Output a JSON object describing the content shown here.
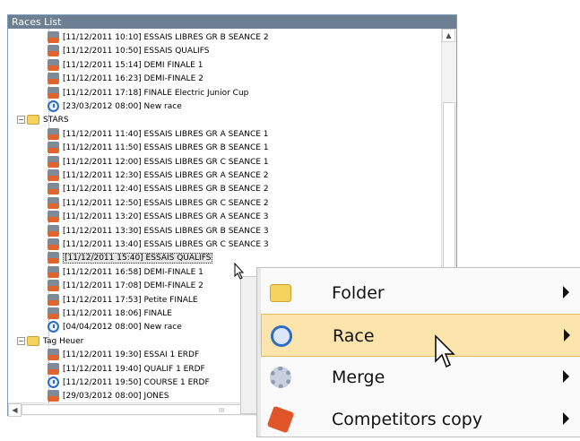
{
  "panel": {
    "title": "Races List"
  },
  "tree": {
    "rows": [
      {
        "text": "[11/12/2011 10:10] ESSAIS LIBRES GR B SEANCE 2",
        "icon": "race-old"
      },
      {
        "text": "[11/12/2011 10:50] ESSAIS QUALIFS",
        "icon": "race-old"
      },
      {
        "text": "[11/12/2011 15:14] DEMI FINALE 1",
        "icon": "race-old"
      },
      {
        "text": "[11/12/2011 16:23] DEMI-FINALE 2",
        "icon": "race-old"
      },
      {
        "text": "[11/12/2011 17:18] FINALE Electric Junior Cup",
        "icon": "race-old"
      },
      {
        "text": "[23/03/2012 08:00] New race",
        "icon": "race-new"
      },
      {
        "text": "STARS",
        "icon": "folder",
        "folder": true
      },
      {
        "text": "[11/12/2011 11:40] ESSAIS LIBRES GR A SEANCE 1",
        "icon": "race-old"
      },
      {
        "text": "[11/12/2011 11:50] ESSAIS LIBRES GR B SEANCE 1",
        "icon": "race-old"
      },
      {
        "text": "[11/12/2011 12:00] ESSAIS LIBRES GR C SEANCE 1",
        "icon": "race-old"
      },
      {
        "text": "[11/12/2011 12:30] ESSAIS LIBRES GR A SEANCE 2",
        "icon": "race-old"
      },
      {
        "text": "[11/12/2011 12:40] ESSAIS LIBRES GR B SEANCE 2",
        "icon": "race-old"
      },
      {
        "text": "[11/12/2011 12:50] ESSAIS LIBRES GR C SEANCE 2",
        "icon": "race-old"
      },
      {
        "text": "[11/12/2011 13:20] ESSAIS LIBRES GR A SEANCE 3",
        "icon": "race-old"
      },
      {
        "text": "[11/12/2011 13:30] ESSAIS LIBRES GR B SEANCE 3",
        "icon": "race-old"
      },
      {
        "text": "[11/12/2011 13:40] ESSAIS LIBRES GR C SEANCE 3",
        "icon": "race-old"
      },
      {
        "text": "[11/12/2011 15:40] ESSAIS QUALIFS",
        "icon": "race-old",
        "selected": true
      },
      {
        "text": "[11/12/2011 16:58] DEMI-FINALE 1",
        "icon": "race-old"
      },
      {
        "text": "[11/12/2011 17:08] DEMI-FINALE 2",
        "icon": "race-old"
      },
      {
        "text": "[11/12/2011 17:53] Petite FINALE",
        "icon": "race-old"
      },
      {
        "text": "[11/12/2011 18:06] FINALE",
        "icon": "race-old"
      },
      {
        "text": "[04/04/2012 08:00] New race",
        "icon": "race-new"
      },
      {
        "text": "Tag Heuer",
        "icon": "folder",
        "folder": true
      },
      {
        "text": "[11/12/2011 19:30] ESSAI 1 ERDF",
        "icon": "race-old"
      },
      {
        "text": "[11/12/2011 19:40] QUALIF 1 ERDF",
        "icon": "race-old"
      },
      {
        "text": "[11/12/2011 19:50] COURSE 1 ERDF",
        "icon": "race-new"
      },
      {
        "text": "[29/03/2012 08:00] JONES",
        "icon": "race-old"
      }
    ]
  },
  "scrollbar": {
    "up_glyph": "▲",
    "left_glyph": "◀",
    "grip_glyph": "III"
  },
  "context_menu": {
    "items": [
      {
        "label": "Folder",
        "icon": "folder-icon"
      },
      {
        "label": "Race",
        "icon": "stopwatch-icon",
        "highlighted": true
      },
      {
        "label": "Merge",
        "icon": "gear-icon"
      },
      {
        "label": "Competitors copy",
        "icon": "copy-icon"
      }
    ]
  },
  "colors": {
    "title_bar": "#6d7f92",
    "menu_highlight": "#fbe5ac",
    "menu_highlight_border": "#e2bb5c"
  }
}
